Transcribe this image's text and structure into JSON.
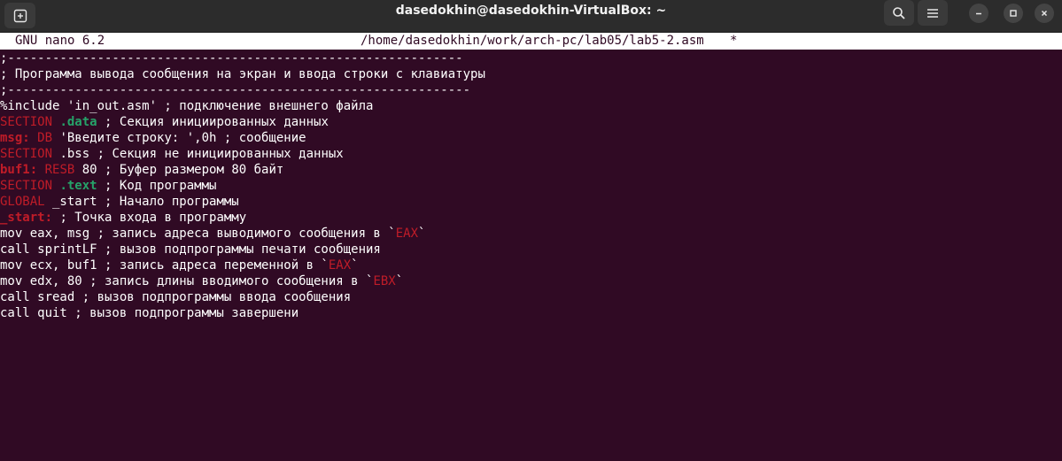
{
  "titlebar": {
    "title": "dasedokhin@dasedokhin-VirtualBox: ~",
    "icons": [
      "new-tab-icon",
      "search-icon",
      "hamburger-menu-icon",
      "minimize-icon",
      "maximize-icon",
      "close-icon"
    ]
  },
  "nano": {
    "version": "GNU nano 6.2",
    "filepath": "/home/dasedokhin/work/arch-pc/lab05/lab5-2.asm",
    "modified": "*"
  },
  "colors": {
    "background": "#300a24",
    "keyword": "#c01c28",
    "section": "#26a269",
    "text": "#ffffff"
  },
  "code": {
    "l0": {
      "a": ";-------------------------------------------------------------"
    },
    "l1": {
      "a": "; Программа вывода сообщения на экран и ввода строки с клавиатуры"
    },
    "l2": {
      "a": ";--------------------------------------------------------------"
    },
    "l3": {
      "a": "%include 'in_out.asm' ; подключение внешнего файла"
    },
    "l4": {
      "kw": "SECTION",
      "sp": " ",
      "sec": ".data",
      "rest": " ; Секция инициированных данных"
    },
    "l5": {
      "lbl": "msg:",
      "sp": " ",
      "kw": "DB",
      "rest": " 'Введите строку: ',0h ; сообщение"
    },
    "l6": {
      "kw": "SECTION",
      "rest": " .bss ; Секция не инициированных данных"
    },
    "l7": {
      "lbl": "buf1:",
      "sp": " ",
      "kw": "RESB",
      "rest": " 80 ; Буфер размером 80 байт"
    },
    "l8": {
      "kw": "SECTION",
      "sp": " ",
      "sec": ".text",
      "rest": " ; Код программы"
    },
    "l9": {
      "kw": "GLOBAL",
      "rest": " _start ; Начало программы"
    },
    "l10": {
      "lbl": "_start:",
      "rest": " ; Точка входа в программу"
    },
    "l11": {
      "a": "mov eax, msg ; запись адреса выводимого сообщения в `",
      "reg": "EAX",
      "b": "`"
    },
    "l12": {
      "a": "call sprintLF ; вызов подпрограммы печати сообщения"
    },
    "l13": {
      "a": "mov ecx, buf1 ; запись адреса переменной в `",
      "reg": "EAX",
      "b": "`"
    },
    "l14": {
      "a": "mov edx, 80 ; запись длины вводимого сообщения в `",
      "reg": "EBX",
      "b": "`"
    },
    "l15": {
      "a": "call sread ; вызов подпрограммы ввода сообщения"
    },
    "l16": {
      "a": "call quit ; вызов подпрограммы завершени"
    }
  }
}
